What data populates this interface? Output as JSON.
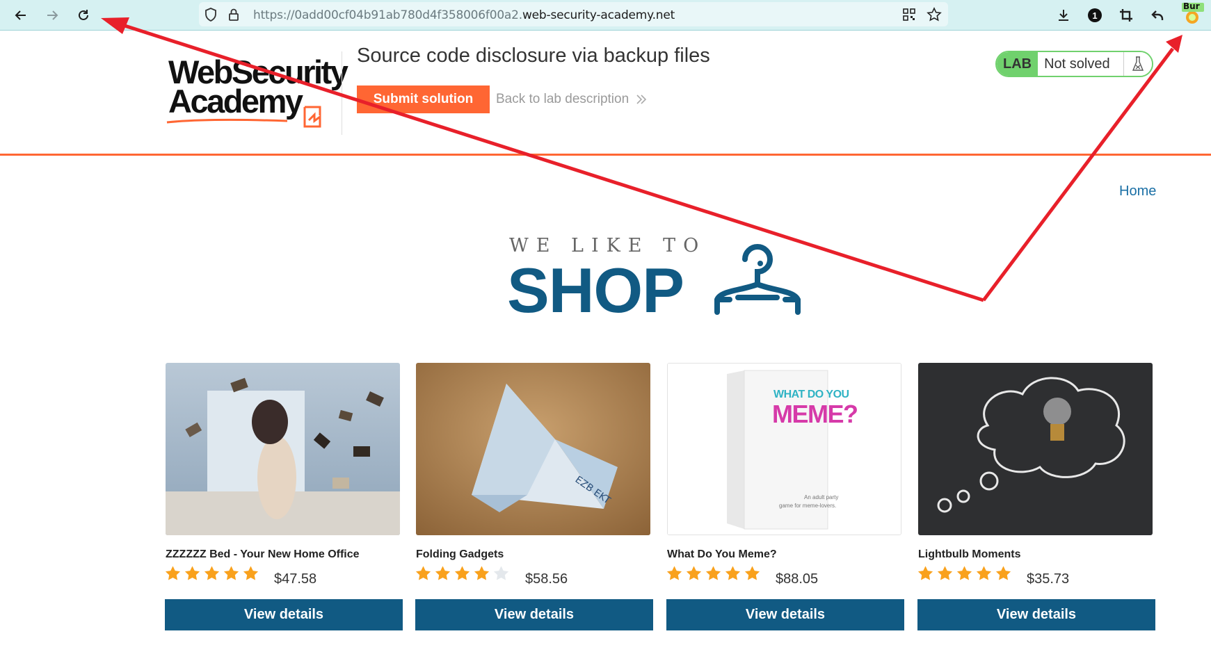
{
  "browser": {
    "url_prefix": "https://0add00cf04b91ab780d4f358006f00a2.",
    "url_domain": "web-security-academy.net",
    "burp_badge": "Bur",
    "password_badge": "1"
  },
  "lab": {
    "logo_line1": "WebSecurity",
    "logo_line2": "Academy",
    "title": "Source code disclosure via backup files",
    "submit_label": "Submit solution",
    "back_label": "Back to lab description",
    "status_tag": "LAB",
    "status_text": "Not solved",
    "colors": {
      "accent": "#ff6633",
      "solved_green": "#70d16d"
    }
  },
  "nav": {
    "home_label": "Home"
  },
  "shop_logo": {
    "tagline": "WE LIKE TO",
    "word": "SHOP"
  },
  "products": [
    {
      "name": "ZZZZZZ Bed - Your New Home Office",
      "rating": 5,
      "price": "$47.58",
      "button": "View details"
    },
    {
      "name": "Folding Gadgets",
      "rating": 4,
      "price": "$58.56",
      "button": "View details"
    },
    {
      "name": "What Do You Meme?",
      "rating": 5,
      "price": "$88.05",
      "button": "View details",
      "box_text_top": "WHAT DO YOU",
      "box_text_main": "MEME?",
      "box_text_small1": "An adult party",
      "box_text_small2": "game for meme-lovers."
    },
    {
      "name": "Lightbulb Moments",
      "rating": 5,
      "price": "$35.73",
      "button": "View details"
    }
  ],
  "colors": {
    "primary": "#115a83",
    "link": "#1a6fa5",
    "star": "#f9a11c",
    "annotation_arrow": "#e8202a"
  }
}
